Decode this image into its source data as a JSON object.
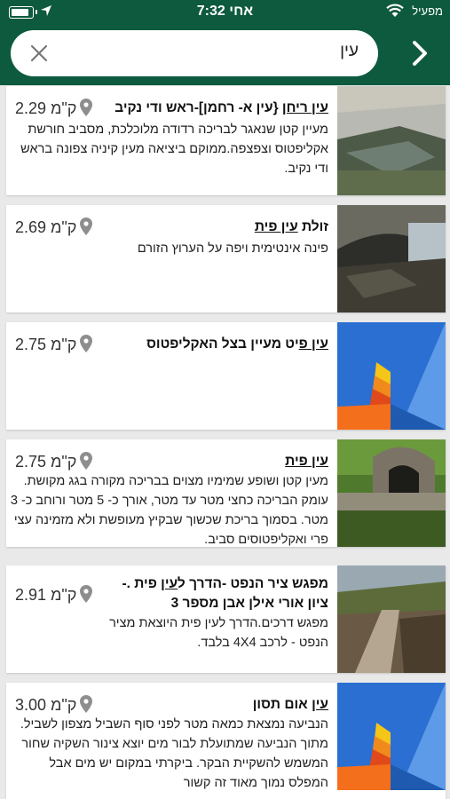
{
  "status_bar": {
    "time": "7:32 אחי",
    "carrier": "מפעיל",
    "battery_level": 0.85
  },
  "search": {
    "query": "עין"
  },
  "icons": {
    "clear": "close-icon",
    "back": "chevron-right-icon",
    "location": "map-pin-icon"
  },
  "colors": {
    "header": "#0d5a3f",
    "background": "#e9e9e9",
    "card": "#ffffff"
  },
  "results": [
    {
      "title_underlined": "עין ריחן",
      "title_rest": " {עין א- רחמן]-ראש ודי נקיב",
      "distance": "2.29 ק\"מ",
      "description": "מעיין קטן שנאגר לבריכה רדודה מלוכלכת, מסביב חורשת אקליפטוס וצפצפה.ממוקם ביציאה מעין קיניה צפונה בראש ודי נקיב.",
      "thumbnail": "photo-spring-pool"
    },
    {
      "title_pre": "זולת ",
      "title_underlined": "עין פית",
      "title_rest": "",
      "distance": "2.69 ק\"מ",
      "description": "פינה אינטימית ויפה על הערוץ הזורם",
      "thumbnail": "photo-tunnel-pool"
    },
    {
      "title_underlined": "עין פ",
      "title_rest": "יט מעיין בצל האקליפטוס",
      "distance": "2.75 ק\"מ",
      "description": "",
      "thumbnail": "placeholder-graphic"
    },
    {
      "title_underlined": "עין פית",
      "title_rest": "",
      "distance": "2.75 ק\"מ",
      "description": "מעין קטן ושופע שמימיו מצוים בבריכה מקורה בגג מקושת. עומק הבריכה כחצי מטר עד מטר, אורך כ- 5 מטר ורוחב כ- 3 מטר. בסמוך בריכת שכשוך שבקיץ מעופשת ולא מזמינה עצי פרי ואקליפטוסים סביב.",
      "thumbnail": "photo-vaulted-spring"
    },
    {
      "title_pre": "מפגש ציר הנפט -הדרך ל",
      "title_underlined": "עין",
      "title_rest": " פית .- ציון אורי אילן אבן מספר 3",
      "distance": "2.91 ק\"מ",
      "description": "מפגש דרכים.הדרך לעין פית היוצאת מציר הנפט - לרכב 4X4 בלבד.",
      "thumbnail": "photo-dirt-road"
    },
    {
      "title_underlined": "עין",
      "title_rest": " אום תסון",
      "distance": "3.00 ק\"מ",
      "description": "הנביעה נמצאת כמאה מטר לפני סוף השביל מצפון לשביל. מתוך הנביעה שמתועלת לבור מים יוצא צינור השקיה שחור המשמש להשקיית הבקר. ביקרתי במקום יש מים אבל המפלס נמוך מאוד זה קשור",
      "thumbnail": "placeholder-graphic"
    }
  ]
}
